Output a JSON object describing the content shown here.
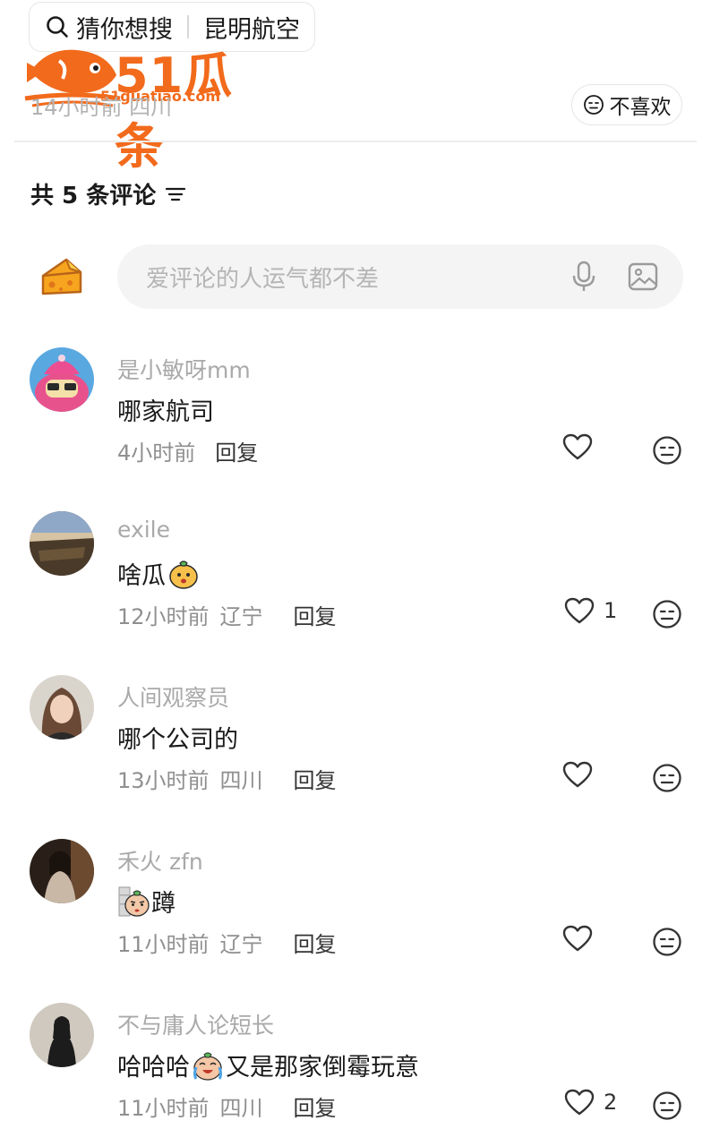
{
  "search": {
    "label": "猜你想搜",
    "query": "昆明航空"
  },
  "watermark": {
    "text": "51瓜条",
    "url": "51guatiao.com"
  },
  "post": {
    "meta": "14小时前 四川",
    "dislike_label": "不喜欢"
  },
  "comments_header": {
    "count_label": "共 5 条评论"
  },
  "input": {
    "placeholder": "爱评论的人运气都不差"
  },
  "colors": {
    "brand_orange": "#f26a1b",
    "text_primary": "#1a1a1a",
    "text_muted": "#a9a9a9"
  },
  "comments": [
    {
      "user": "是小敏呀mm",
      "text": "哪家航司",
      "time": "4小时前",
      "location": "",
      "reply": "回复",
      "likes": ""
    },
    {
      "user": "exile",
      "text": "啥瓜",
      "time": "12小时前",
      "location": "辽宁",
      "reply": "回复",
      "likes": "1"
    },
    {
      "user": "人间观察员",
      "text": "哪个公司的",
      "time": "13小时前",
      "location": "四川",
      "reply": "回复",
      "likes": ""
    },
    {
      "user": "禾火 zfn",
      "text": "蹲",
      "time": "11小时前",
      "location": "辽宁",
      "reply": "回复",
      "likes": ""
    },
    {
      "user": "不与庸人论短长",
      "text": "哈哈哈",
      "text2": "又是那家倒霉玩意",
      "time": "11小时前",
      "location": "四川",
      "reply": "回复",
      "likes": "2"
    }
  ]
}
